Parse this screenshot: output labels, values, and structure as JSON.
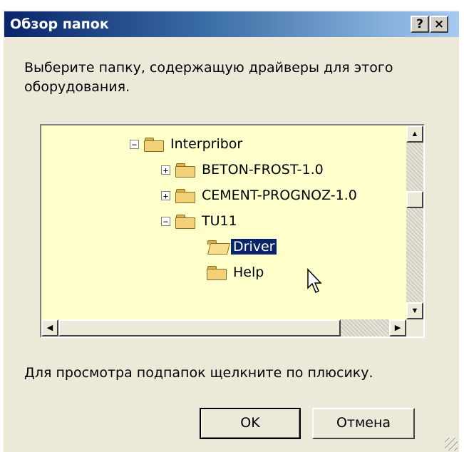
{
  "window": {
    "title": "Обзор папок",
    "help_label": "?",
    "close_label": "×"
  },
  "description": "Выберите папку, содержащую драйверы для этого оборудования.",
  "tree": {
    "nodes": [
      {
        "label": "Interpribor",
        "expander": "−",
        "folder": "closed"
      },
      {
        "label": "BETON-FROST-1.0",
        "expander": "+",
        "folder": "closed"
      },
      {
        "label": "CEMENT-PROGNOZ-1.0",
        "expander": "+",
        "folder": "closed"
      },
      {
        "label": "TU11",
        "expander": "−",
        "folder": "closed"
      },
      {
        "label": "Driver",
        "expander": "",
        "folder": "open",
        "selected": true
      },
      {
        "label": "Help",
        "expander": "",
        "folder": "closed"
      }
    ],
    "scroll_up": "▲",
    "scroll_down": "▼",
    "scroll_left": "◀",
    "scroll_right": "▶"
  },
  "hint": "Для просмотра подпапок щелкните по плюсику.",
  "buttons": {
    "ok": "OK",
    "cancel": "Отмена"
  },
  "colors": {
    "titlebar_start": "#0a246a",
    "titlebar_end": "#a6caf0",
    "tree_bg": "#ffffcc",
    "selection": "#0a246a",
    "dialog_bg": "#ece9d8"
  }
}
